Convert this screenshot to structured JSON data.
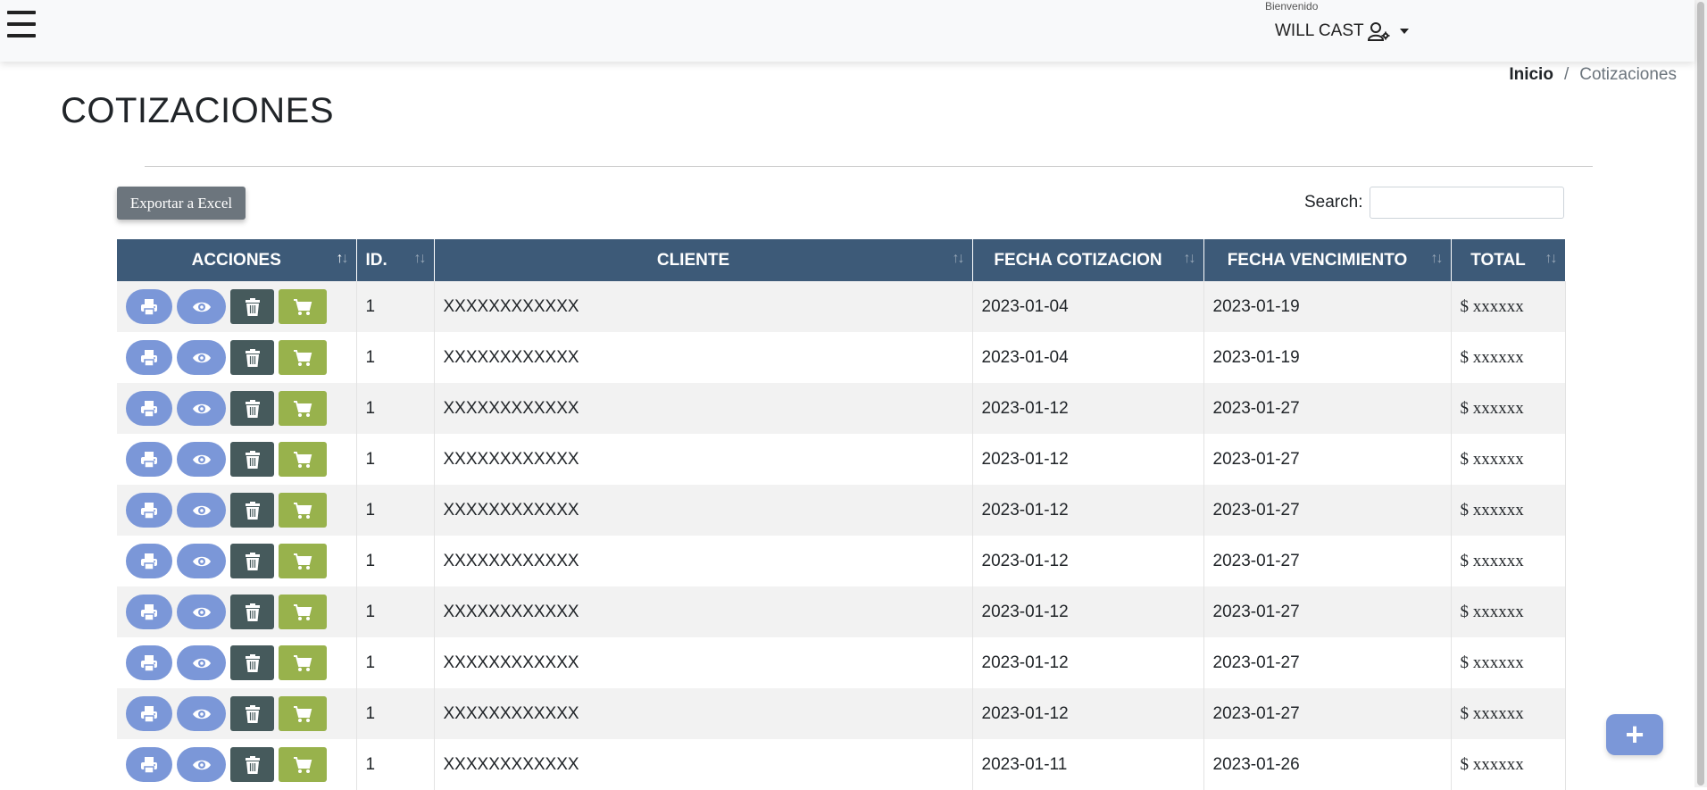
{
  "header": {
    "welcome": "Bienvenido",
    "user_name": "WILL CAST"
  },
  "breadcrumb": {
    "home": "Inicio",
    "separator": "/",
    "current": "Cotizaciones"
  },
  "page": {
    "title": "COTIZACIONES"
  },
  "toolbar": {
    "export_label": "Exportar a Excel",
    "search_label": "Search:",
    "search_value": ""
  },
  "table": {
    "columns": {
      "actions": "ACCIONES",
      "id": "ID.",
      "client": "CLIENTE",
      "quote_date": "FECHA COTIZACION",
      "due_date": "FECHA VENCIMIENTO",
      "total": "TOTAL"
    },
    "rows": [
      {
        "id": "1",
        "client": "XXXXXXXXXXXX",
        "quote_date": "2023-01-04",
        "due_date": "2023-01-19",
        "total": "$ xxxxxx"
      },
      {
        "id": "1",
        "client": "XXXXXXXXXXXX",
        "quote_date": "2023-01-04",
        "due_date": "2023-01-19",
        "total": "$ xxxxxx"
      },
      {
        "id": "1",
        "client": "XXXXXXXXXXXX",
        "quote_date": "2023-01-12",
        "due_date": "2023-01-27",
        "total": "$ xxxxxx"
      },
      {
        "id": "1",
        "client": "XXXXXXXXXXXX",
        "quote_date": "2023-01-12",
        "due_date": "2023-01-27",
        "total": "$ xxxxxx"
      },
      {
        "id": "1",
        "client": "XXXXXXXXXXXX",
        "quote_date": "2023-01-12",
        "due_date": "2023-01-27",
        "total": "$ xxxxxx"
      },
      {
        "id": "1",
        "client": "XXXXXXXXXXXX",
        "quote_date": "2023-01-12",
        "due_date": "2023-01-27",
        "total": "$ xxxxxx"
      },
      {
        "id": "1",
        "client": "XXXXXXXXXXXX",
        "quote_date": "2023-01-12",
        "due_date": "2023-01-27",
        "total": "$ xxxxxx"
      },
      {
        "id": "1",
        "client": "XXXXXXXXXXXX",
        "quote_date": "2023-01-12",
        "due_date": "2023-01-27",
        "total": "$ xxxxxx"
      },
      {
        "id": "1",
        "client": "XXXXXXXXXXXX",
        "quote_date": "2023-01-12",
        "due_date": "2023-01-27",
        "total": "$ xxxxxx"
      },
      {
        "id": "1",
        "client": "XXXXXXXXXXXX",
        "quote_date": "2023-01-11",
        "due_date": "2023-01-26",
        "total": "$ xxxxxx"
      }
    ]
  },
  "icons": {
    "menu": "hamburger-menu-icon",
    "user": "user-cog-icon",
    "print": "print-icon",
    "view": "eye-icon",
    "delete": "trash-icon",
    "cart": "shopping-cart-icon",
    "add": "plus-icon"
  },
  "colors": {
    "table_header": "#3d5a78",
    "action_blue": "#7b97d8",
    "delete_dark": "#465a5c",
    "cart_green": "#98b24c",
    "export_gray": "#6c757d"
  }
}
